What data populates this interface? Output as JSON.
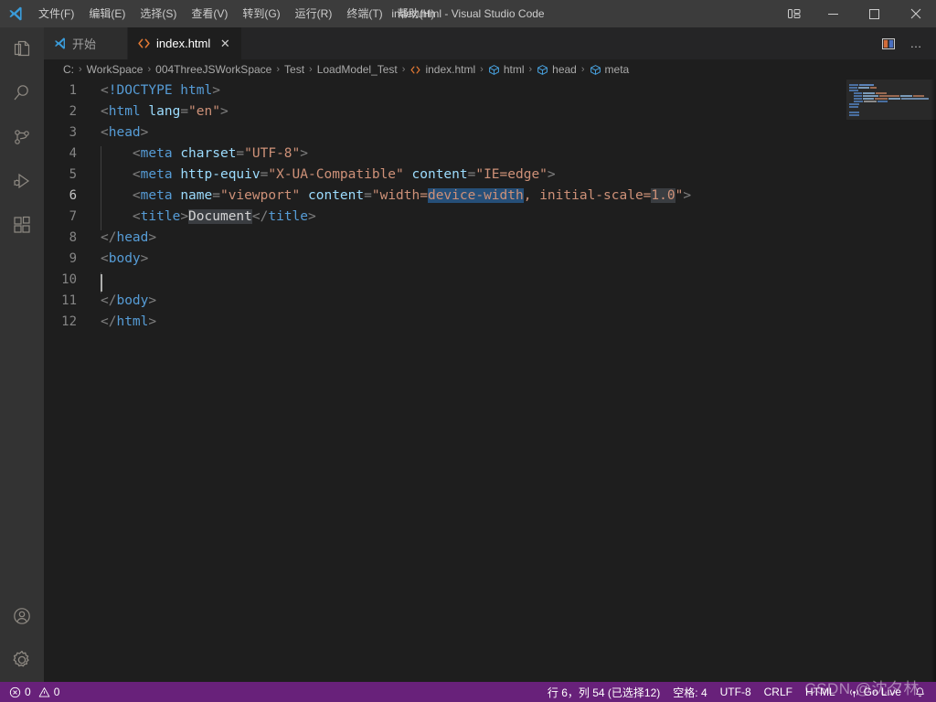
{
  "window": {
    "title": "index.html - Visual Studio Code",
    "logo_icon": "vscode-logo-icon",
    "layout_icon": "customize-layout-icon",
    "minimize_label": "─",
    "maximize_label": "☐",
    "close_label": "✕"
  },
  "menubar": {
    "items": [
      {
        "label": "文件(F)",
        "name": "menu-file"
      },
      {
        "label": "编辑(E)",
        "name": "menu-edit"
      },
      {
        "label": "选择(S)",
        "name": "menu-selection"
      },
      {
        "label": "查看(V)",
        "name": "menu-view"
      },
      {
        "label": "转到(G)",
        "name": "menu-go"
      },
      {
        "label": "运行(R)",
        "name": "menu-run"
      },
      {
        "label": "终端(T)",
        "name": "menu-terminal"
      },
      {
        "label": "帮助(H)",
        "name": "menu-help"
      }
    ]
  },
  "activitybar": {
    "items": [
      {
        "name": "explorer-icon",
        "label": "Explorer"
      },
      {
        "name": "search-icon",
        "label": "Search"
      },
      {
        "name": "source-control-icon",
        "label": "Source Control"
      },
      {
        "name": "run-and-debug-icon",
        "label": "Run and Debug"
      },
      {
        "name": "extensions-icon",
        "label": "Extensions"
      }
    ],
    "bottom": [
      {
        "name": "account-icon",
        "label": "Accounts"
      },
      {
        "name": "settings-gear-icon",
        "label": "Manage"
      }
    ]
  },
  "tabs": [
    {
      "label": "开始",
      "icon": "vscode-logo-icon",
      "active": false
    },
    {
      "label": "index.html",
      "icon": "html-file-icon",
      "active": true,
      "close_label": "✕"
    }
  ],
  "tab_actions": {
    "split_icon": "split-editor-icon",
    "more_label": "…"
  },
  "breadcrumbs": [
    {
      "label": "C:",
      "icon": ""
    },
    {
      "label": "WorkSpace",
      "icon": ""
    },
    {
      "label": "004ThreeJSWorkSpace",
      "icon": ""
    },
    {
      "label": "Test",
      "icon": ""
    },
    {
      "label": "LoadModel_Test",
      "icon": ""
    },
    {
      "label": "index.html",
      "icon": "html-file-icon"
    },
    {
      "label": "html",
      "icon": "symbol-field-icon"
    },
    {
      "label": "head",
      "icon": "symbol-field-icon"
    },
    {
      "label": "meta",
      "icon": "symbol-field-icon"
    }
  ],
  "breadcrumb_separator": "›",
  "editor": {
    "lines": [
      {
        "no": "1",
        "text": "<!DOCTYPE html>"
      },
      {
        "no": "2",
        "text": "<html lang=\"en\">"
      },
      {
        "no": "3",
        "text": "<head>"
      },
      {
        "no": "4",
        "text": "    <meta charset=\"UTF-8\">"
      },
      {
        "no": "5",
        "text": "    <meta http-equiv=\"X-UA-Compatible\" content=\"IE=edge\">"
      },
      {
        "no": "6",
        "text": "    <meta name=\"viewport\" content=\"width=device-width, initial-scale=1.0\">"
      },
      {
        "no": "7",
        "text": "    <title>Document</title>"
      },
      {
        "no": "8",
        "text": "</head>"
      },
      {
        "no": "9",
        "text": "<body>"
      },
      {
        "no": "10",
        "text": "    "
      },
      {
        "no": "11",
        "text": "</body>"
      },
      {
        "no": "12",
        "text": "</html>"
      }
    ],
    "selected_text": "device-width",
    "current_line": "6"
  },
  "statusbar": {
    "errors_icon": "error-circle-icon",
    "errors_count": "0",
    "warnings_icon": "warning-triangle-icon",
    "warnings_count": "0",
    "position": "行 6，列 54 (已选择12)",
    "indentation": "空格: 4",
    "encoding": "UTF-8",
    "eol": "CRLF",
    "language": "HTML",
    "golive_icon": "broadcast-icon",
    "golive_label": "Go Live",
    "bell_icon": "bell-icon"
  },
  "watermark": {
    "text": "CSDN @沈夕林"
  },
  "colors": {
    "titlebar_bg": "#3c3c3c",
    "activitybar_bg": "#333333",
    "tabbar_bg": "#252526",
    "editor_bg": "#1e1e1e",
    "statusbar_bg": "#68217a",
    "selection_bg": "#264f78",
    "tag_color": "#569cd6",
    "attr_color": "#9cdcfe",
    "string_color": "#ce9178",
    "html_icon_color": "#e37933"
  }
}
